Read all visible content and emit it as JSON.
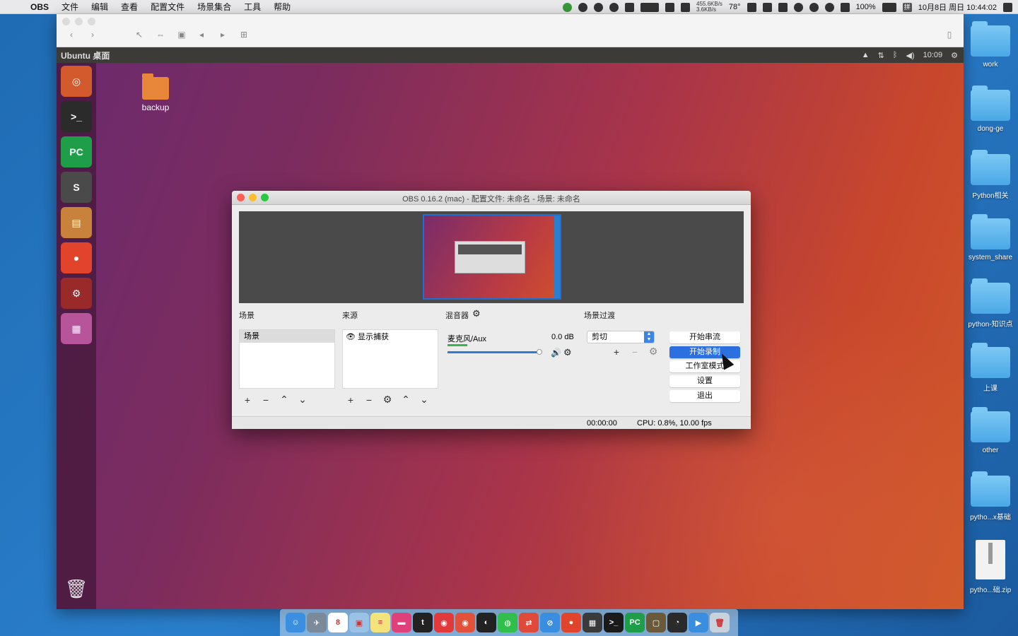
{
  "mac_menubar": {
    "apple": "",
    "items": [
      "OBS",
      "文件",
      "编辑",
      "查看",
      "配置文件",
      "场景集合",
      "工具",
      "帮助"
    ],
    "status": {
      "net_speed_up": "455.6KB/s",
      "net_speed_down": "3.6KB/s",
      "temperature": "78°",
      "battery": "100%",
      "input_method": "拼",
      "datetime": "10月8日 周日 10:44:02"
    }
  },
  "vm_window": {
    "title": "Ubuntu 桌面",
    "clock": "10:09"
  },
  "ubuntu_desktop": {
    "folder_label": "backup",
    "launcher": [
      {
        "name": "dash",
        "glyph": "◎",
        "color": "#d35a2c"
      },
      {
        "name": "terminal",
        "glyph": ">_",
        "color": "#2b2b2b"
      },
      {
        "name": "pycharm",
        "glyph": "PC",
        "color": "#1f9e4a"
      },
      {
        "name": "sublime",
        "glyph": "S",
        "color": "#4a4a4a"
      },
      {
        "name": "files",
        "glyph": "▤",
        "color": "#c9823c"
      },
      {
        "name": "chrome",
        "glyph": "●",
        "color": "#e2432b"
      },
      {
        "name": "settings",
        "glyph": "⚙",
        "color": "#9a2a2a"
      },
      {
        "name": "workspaces",
        "glyph": "▦",
        "color": "#b8559a"
      }
    ]
  },
  "obs": {
    "title": "OBS 0.16.2 (mac) - 配置文件: 未命名 - 场景: 未命名",
    "scenes_label": "场景",
    "sources_label": "来源",
    "mixer_label": "混音器",
    "transitions_label": "场景过渡",
    "scene_item": "场景",
    "source_item": "显示捕获",
    "mixer_track": "麦克风/Aux",
    "mixer_db": "0.0 dB",
    "mixer_volume_fraction": 1.0,
    "transition_selected": "剪切",
    "buttons": {
      "stream": "开始串流",
      "record": "开始录制",
      "studio": "工作室模式",
      "settings": "设置",
      "exit": "退出"
    },
    "status_time": "00:00:00",
    "status_cpu": "CPU: 0.8%, 10.00 fps"
  },
  "desktop_icons": [
    {
      "label": "work",
      "kind": "folder"
    },
    {
      "label": "dong-ge",
      "kind": "folder"
    },
    {
      "label": "Python相关",
      "kind": "folder"
    },
    {
      "label": "system_share",
      "kind": "folder"
    },
    {
      "label": "python-知识点",
      "kind": "folder"
    },
    {
      "label": "上课",
      "kind": "folder"
    },
    {
      "label": "other",
      "kind": "folder"
    },
    {
      "label": "pytho...x基础",
      "kind": "folder"
    },
    {
      "label": "pytho...础.zip",
      "kind": "zip"
    }
  ],
  "dock": [
    {
      "name": "finder",
      "glyph": "☺",
      "color": "#3b8fe0"
    },
    {
      "name": "launchpad",
      "glyph": "✈",
      "color": "#7a8a99"
    },
    {
      "name": "calendar",
      "glyph": "8",
      "color": "#ffffff"
    },
    {
      "name": "preview",
      "glyph": "▣",
      "color": "#9ac2e6"
    },
    {
      "name": "notes",
      "glyph": "≡",
      "color": "#f4e27a"
    },
    {
      "name": "screen",
      "glyph": "▬",
      "color": "#e0407a"
    },
    {
      "name": "tumblr",
      "glyph": "t",
      "color": "#222222"
    },
    {
      "name": "netease",
      "glyph": "◉",
      "color": "#e23a3a"
    },
    {
      "name": "weibo",
      "glyph": "◉",
      "color": "#e2513a"
    },
    {
      "name": "qq",
      "glyph": "◐",
      "color": "#222222"
    },
    {
      "name": "wechat",
      "glyph": "◍",
      "color": "#2fbf4a"
    },
    {
      "name": "xmind",
      "glyph": "⇄",
      "color": "#e04a3a"
    },
    {
      "name": "safari",
      "glyph": "⊘",
      "color": "#3a8ee0"
    },
    {
      "name": "chrome",
      "glyph": "●",
      "color": "#e2432b"
    },
    {
      "name": "activity",
      "glyph": "▦",
      "color": "#3a3a3a"
    },
    {
      "name": "terminal",
      "glyph": ">_",
      "color": "#1a1a1a"
    },
    {
      "name": "pycharm",
      "glyph": "PC",
      "color": "#1f9e4a"
    },
    {
      "name": "virtualbox",
      "glyph": "▢",
      "color": "#6a5a3a"
    },
    {
      "name": "obs",
      "glyph": "◔",
      "color": "#2a2a2a"
    },
    {
      "name": "quicktime",
      "glyph": "▶",
      "color": "#3a8ee0"
    },
    {
      "name": "trash",
      "glyph": "🗑",
      "color": "#c8d2dc"
    }
  ]
}
